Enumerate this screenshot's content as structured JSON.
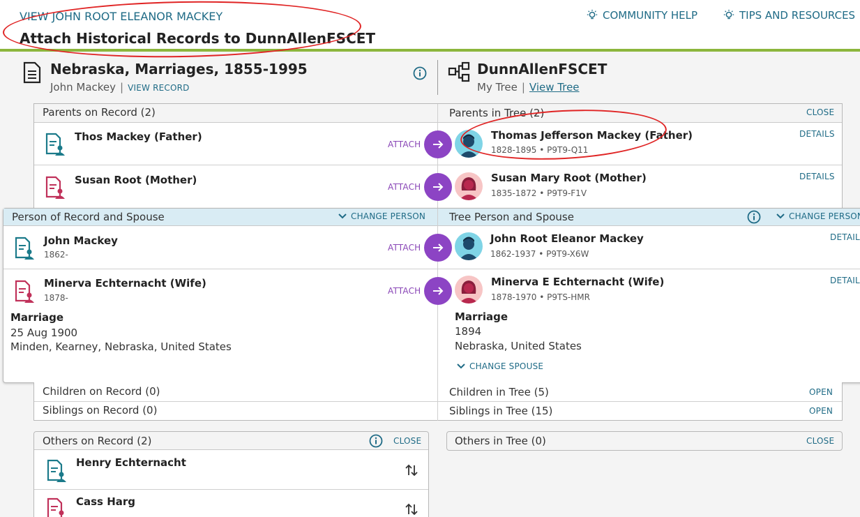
{
  "header": {
    "breadcrumb": "VIEW JOHN ROOT ELEANOR MACKEY",
    "title": "Attach Historical Records to DunnAllenFSCET",
    "community_help": "COMMUNITY HELP",
    "tips": "TIPS AND RESOURCES"
  },
  "record": {
    "title": "Nebraska, Marriages, 1855-1995",
    "person": "John Mackey",
    "view_record": "VIEW RECORD"
  },
  "tree": {
    "title": "DunnAllenFSCET",
    "my_tree": "My Tree",
    "view_tree": "View Tree"
  },
  "parents": {
    "record_header": "Parents on Record (2)",
    "tree_header": "Parents in Tree (2)",
    "close": "CLOSE",
    "rows": [
      {
        "record_name": "Thos Mackey (Father)",
        "attach": "ATTACH",
        "tree_name": "Thomas Jefferson Mackey (Father)",
        "tree_sub": "1828-1895 • P9T9-Q11",
        "details": "DETAILS"
      },
      {
        "record_name": "Susan Root (Mother)",
        "attach": "ATTACH",
        "tree_name": "Susan Mary Root (Mother)",
        "tree_sub": "1835-1872 • P9T9-F1V",
        "details": "DETAILS"
      }
    ]
  },
  "spouse": {
    "record_header": "Person of Record and Spouse",
    "change_person": "CHANGE PERSON",
    "tree_header": "Tree Person and Spouse",
    "rows": [
      {
        "record_name": "John Mackey",
        "record_sub": "1862-",
        "attach": "ATTACH",
        "tree_name": "John Root Eleanor Mackey",
        "tree_sub": "1862-1937 • P9T9-X6W",
        "details": "DETAILS"
      },
      {
        "record_name": "Minerva Echternacht (Wife)",
        "record_sub": "1878-",
        "attach": "ATTACH",
        "tree_name": "Minerva E Echternacht (Wife)",
        "tree_sub": "1878-1970 • P9TS-HMR",
        "details": "DETAILS"
      }
    ],
    "record_marriage": {
      "label": "Marriage",
      "date": "25 Aug 1900",
      "place": "Minden, Kearney, Nebraska, United States"
    },
    "tree_marriage": {
      "label": "Marriage",
      "date": "1894",
      "place": "Nebraska, United States"
    },
    "change_spouse": "CHANGE SPOUSE"
  },
  "children": {
    "record": "Children on Record (0)",
    "tree": "Children in Tree (5)",
    "open": "OPEN"
  },
  "siblings": {
    "record": "Siblings on Record (0)",
    "tree": "Siblings in Tree (15)",
    "open": "OPEN"
  },
  "others": {
    "record_header": "Others on Record (2)",
    "close": "CLOSE",
    "tree_header": "Others in Tree (0)",
    "tree_close": "CLOSE",
    "people": [
      "Henry Echternacht",
      "Cass Harg"
    ]
  },
  "colors": {
    "accent": "#8c44c4",
    "link": "#1f6b86",
    "bar": "#8cb63c",
    "annotation": "#e02424"
  }
}
